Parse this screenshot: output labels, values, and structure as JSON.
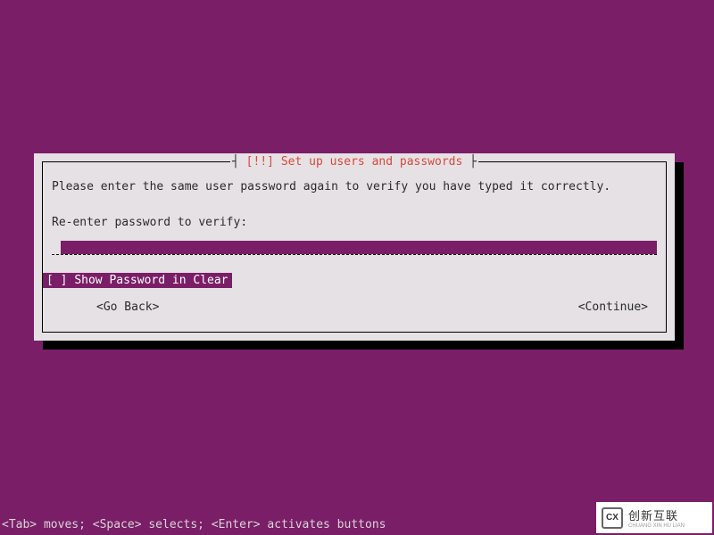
{
  "dialog": {
    "title_bracket_open": "┤ ",
    "title_marker": "[!!]",
    "title_text": " Set up users and passwords",
    "title_bracket_close": " ├",
    "body": "Please enter the same user password again to verify you have typed it correctly.",
    "prompt": "Re-enter password to verify:",
    "password_value": "",
    "checkbox": {
      "state": "[ ]",
      "label": "Show Password in Clear"
    },
    "nav": {
      "back": "<Go Back>",
      "continue": "<Continue>"
    }
  },
  "footer": "<Tab> moves; <Space> selects; <Enter> activates buttons",
  "watermark": {
    "logo": "CX",
    "brand": "创新互联",
    "sub": "CHUANG XIN HU LIAN"
  }
}
